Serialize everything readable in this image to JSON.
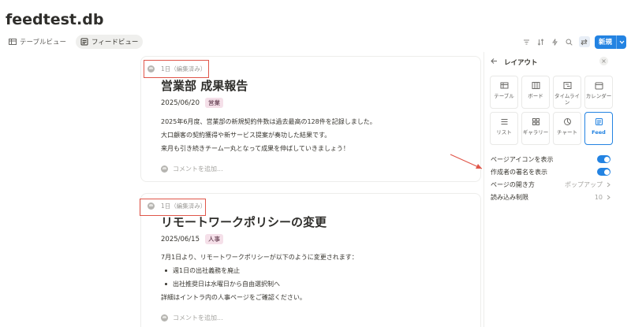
{
  "app": {
    "title": "feedtest.db"
  },
  "views": [
    {
      "label": "テーブルビュー",
      "icon": "table-icon"
    },
    {
      "label": "フィードビュー",
      "icon": "feed-icon"
    }
  ],
  "toolbar": {
    "new_label": "新規",
    "icons": [
      "filter-icon",
      "sort-icon",
      "automation-icon",
      "search-icon",
      "settings-icon"
    ]
  },
  "posts": [
    {
      "meta": "1日（編集済み）",
      "title": "営業部 成果報告",
      "date": "2025/06/20",
      "tag": "営業",
      "lines": [
        "2025年6月度、営業部の新規契約件数は過去最高の128件を記録しました。",
        "大口顧客の契約獲得や新サービス提案が奏功した結果です。",
        "来月も引き続きチーム一丸となって成果を伸ばしていきましょう！"
      ],
      "comment_placeholder": "コメントを追加..."
    },
    {
      "meta": "1日（編集済み）",
      "title": "リモートワークポリシーの変更",
      "date": "2025/06/15",
      "tag": "人事",
      "intro": "7月1日より、リモートワークポリシーが以下のように変更されます：",
      "bullets": [
        "週1日の出社義務を廃止",
        "出社推奨日は水曜日から自由選択制へ"
      ],
      "outro": "詳細はイントラ内の人事ページをご確認ください。",
      "comment_placeholder": "コメントを追加..."
    }
  ],
  "panel": {
    "title": "レイアウト",
    "layouts": [
      {
        "label": "テーブル",
        "icon": "table-icon"
      },
      {
        "label": "ボード",
        "icon": "board-icon"
      },
      {
        "label": "タイムライン",
        "icon": "timeline-icon"
      },
      {
        "label": "カレンダー",
        "icon": "calendar-icon"
      },
      {
        "label": "リスト",
        "icon": "list-icon"
      },
      {
        "label": "ギャラリー",
        "icon": "gallery-icon"
      },
      {
        "label": "チャート",
        "icon": "chart-icon"
      },
      {
        "label": "Feed",
        "icon": "feed-icon",
        "selected": true
      }
    ],
    "settings": [
      {
        "label": "ページアイコンを表示",
        "toggle": true
      },
      {
        "label": "作成者の署名を表示",
        "toggle": true
      },
      {
        "label": "ページの開き方",
        "value": "ポップアップ"
      },
      {
        "label": "読み込み制限",
        "value": "10"
      }
    ]
  },
  "colors": {
    "accent": "#2383e2",
    "annotation": "#e0564a",
    "tag_bg": "#f5e0e9"
  }
}
